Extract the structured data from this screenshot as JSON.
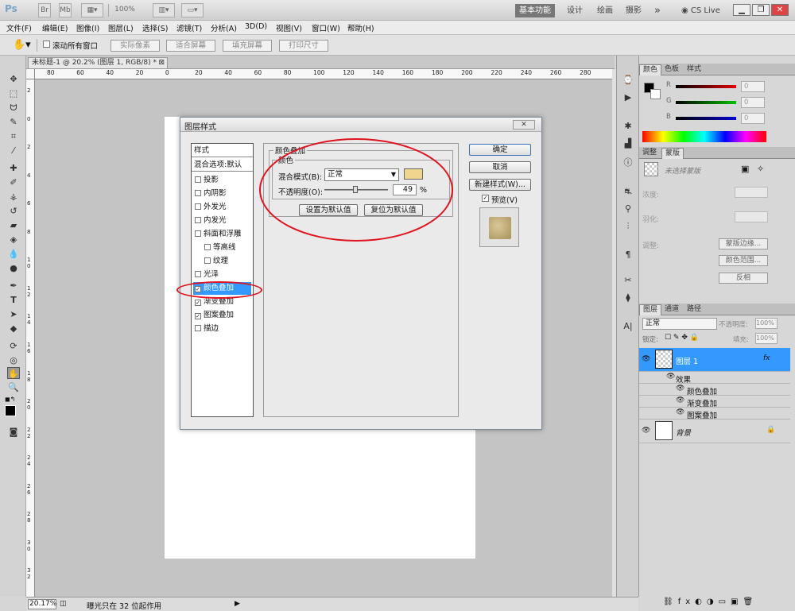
{
  "app": {
    "logo": "Ps",
    "zoom_display": "100%",
    "workspaces": [
      "基本功能",
      "设计",
      "绘画",
      "摄影"
    ],
    "more_symbol": "»",
    "cs_live": "CS Live"
  },
  "menu": [
    "文件(F)",
    "编辑(E)",
    "图像(I)",
    "图层(L)",
    "选择(S)",
    "滤镜(T)",
    "分析(A)",
    "3D(D)",
    "视图(V)",
    "窗口(W)",
    "帮助(H)"
  ],
  "options_bar": {
    "scroll_all_label": "滚动所有窗口",
    "buttons": [
      "实际像素",
      "适合屏幕",
      "填充屏幕",
      "打印尺寸"
    ]
  },
  "document": {
    "tab_title": "未标题-1 @ 20.2% (图层 1, RGB/8) *",
    "ruler_h": [
      "80",
      "60",
      "40",
      "20",
      "0",
      "20",
      "40",
      "60",
      "80",
      "100",
      "120",
      "140",
      "160",
      "180",
      "200",
      "220",
      "240",
      "260",
      "280"
    ],
    "ruler_v": [
      "2",
      "0",
      "2",
      "4",
      "6",
      "8",
      "1 0",
      "1 2",
      "1 4",
      "1 6",
      "1 8",
      "2 0",
      "2 2",
      "2 4",
      "2 6",
      "2 8",
      "3 0",
      "3 2"
    ]
  },
  "status": {
    "zoom": "20.17%",
    "message": "曝光只在 32 位起作用"
  },
  "panels": {
    "color_tabs": [
      "颜色",
      "色板",
      "样式"
    ],
    "color_values": [
      "0",
      "0",
      "0"
    ],
    "color_labels": [
      "R",
      "G",
      "B"
    ],
    "adjust_tabs": [
      "调整",
      "蒙版"
    ],
    "mask_status": "未选择蒙版",
    "density_label": "浓度:",
    "feather_label": "羽化:",
    "refine_label": "调整:",
    "mask_buttons": [
      "蒙版边缘...",
      "颜色范围...",
      "反相"
    ],
    "layers_tabs": [
      "图层",
      "通道",
      "路径"
    ],
    "blend_mode": "正常",
    "opacity_label": "不透明度:",
    "opacity_value": "100%",
    "lock_label": "锁定:",
    "fill_label": "填充:",
    "fill_value": "100%",
    "layers": [
      {
        "name": "图层 1",
        "fx": "fx"
      },
      {
        "name": "效果"
      },
      {
        "name": "颜色叠加"
      },
      {
        "name": "渐变叠加"
      },
      {
        "name": "图案叠加"
      },
      {
        "name": "背景"
      }
    ]
  },
  "dialog": {
    "title": "图层样式",
    "style_header": "样式",
    "blend_options": "混合选项:默认",
    "styles": [
      {
        "label": "投影",
        "checked": false,
        "indent": false
      },
      {
        "label": "内阴影",
        "checked": false,
        "indent": false
      },
      {
        "label": "外发光",
        "checked": false,
        "indent": false
      },
      {
        "label": "内发光",
        "checked": false,
        "indent": false
      },
      {
        "label": "斜面和浮雕",
        "checked": false,
        "indent": false
      },
      {
        "label": "等高线",
        "checked": false,
        "indent": true
      },
      {
        "label": "纹理",
        "checked": false,
        "indent": true
      },
      {
        "label": "光泽",
        "checked": false,
        "indent": false
      },
      {
        "label": "颜色叠加",
        "checked": true,
        "indent": false,
        "selected": true
      },
      {
        "label": "渐变叠加",
        "checked": true,
        "indent": false
      },
      {
        "label": "图案叠加",
        "checked": true,
        "indent": false
      },
      {
        "label": "描边",
        "checked": false,
        "indent": false
      }
    ],
    "section_title": "颜色叠加",
    "group_title": "颜色",
    "blend_mode_label": "混合模式(B):",
    "blend_mode_value": "正常",
    "overlay_color": "#f0d58e",
    "opacity_label": "不透明度(O):",
    "opacity_value": "49",
    "opacity_fraction": 0.49,
    "percent": "%",
    "set_default": "设置为默认值",
    "reset_default": "复位为默认值",
    "ok": "确定",
    "cancel": "取消",
    "new_style": "新建样式(W)...",
    "preview": "预览(V)",
    "close_glyph": "✕"
  },
  "colors": {
    "accent": "#3399ff",
    "annotation": "#e0121e"
  }
}
